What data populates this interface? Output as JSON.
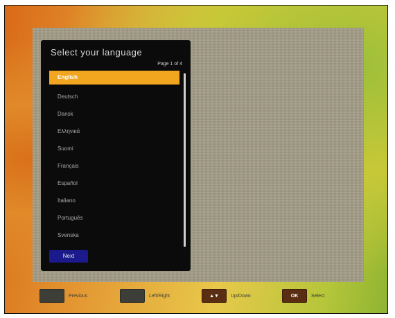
{
  "dialog": {
    "title": "Select your language",
    "page_indicator": "Page 1 of 4"
  },
  "languages": [
    {
      "label": "English",
      "selected": true
    },
    {
      "label": "Deutsch",
      "selected": false
    },
    {
      "label": "Dansk",
      "selected": false
    },
    {
      "label": "Ελληνικά",
      "selected": false
    },
    {
      "label": "Suomi",
      "selected": false
    },
    {
      "label": "Français",
      "selected": false
    },
    {
      "label": "Español",
      "selected": false
    },
    {
      "label": "Italiano",
      "selected": false
    },
    {
      "label": "Português",
      "selected": false
    },
    {
      "label": "Svenska",
      "selected": false
    }
  ],
  "next_button": "Next",
  "footer": {
    "previous": "Previous",
    "leftright": "Left/Right",
    "updown_key": "▲▼",
    "updown": "Up/Down",
    "ok_key": "OK",
    "select": "Select"
  },
  "colors": {
    "highlight": "#f2a51e",
    "next_button": "#1a1a8c",
    "panel": "#a29c86"
  }
}
